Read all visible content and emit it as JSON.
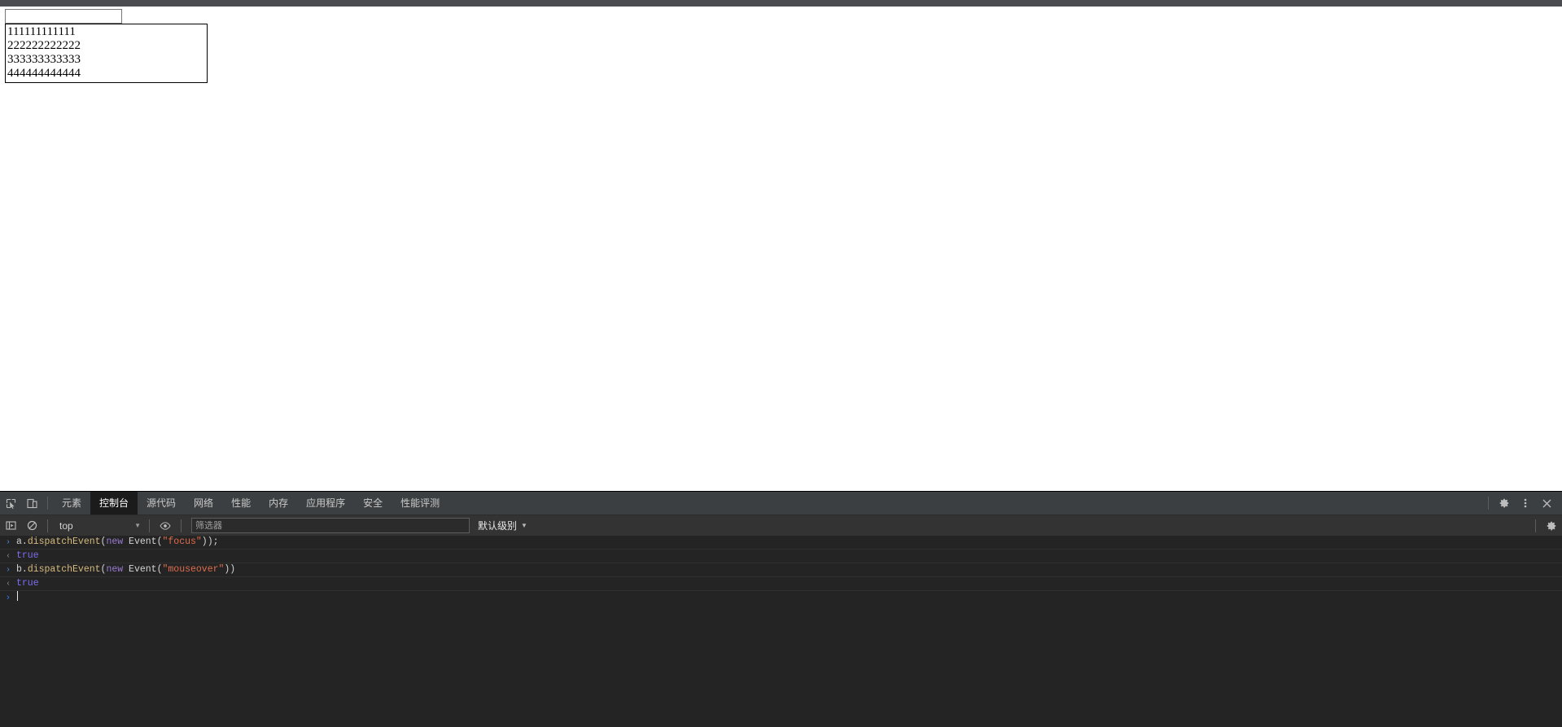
{
  "page": {
    "input_value": "",
    "input_placeholder": "",
    "textarea_value": "111111111111\n222222222222\n333333333333\n444444444444"
  },
  "devtools": {
    "tabbar": {
      "inspect_icon": "inspect-element-icon",
      "device_icon": "device-toolbar-icon",
      "tabs": [
        {
          "label": "元素",
          "name": "elements",
          "active": false
        },
        {
          "label": "控制台",
          "name": "console",
          "active": true
        },
        {
          "label": "源代码",
          "name": "sources",
          "active": false
        },
        {
          "label": "网络",
          "name": "network",
          "active": false
        },
        {
          "label": "性能",
          "name": "performance",
          "active": false
        },
        {
          "label": "内存",
          "name": "memory",
          "active": false
        },
        {
          "label": "应用程序",
          "name": "application",
          "active": false
        },
        {
          "label": "安全",
          "name": "security",
          "active": false
        },
        {
          "label": "性能评测",
          "name": "lighthouse",
          "active": false
        }
      ],
      "settings_icon": "gear-icon",
      "more_icon": "kebab-menu-icon",
      "close_icon": "close-icon"
    },
    "filterbar": {
      "sidebar_icon": "console-sidebar-icon",
      "clear_icon": "clear-console-icon",
      "context_value": "top",
      "context_caret": "▼",
      "eye_icon": "live-expression-icon",
      "filter_value": "",
      "filter_placeholder": "筛选器",
      "levels_label": "默认级别",
      "levels_caret": "▼",
      "settings_icon": "gear-icon"
    },
    "console": {
      "rows": [
        {
          "kind": "input",
          "gutter": "›",
          "tokens": [
            {
              "t": "a.",
              "c": "tok-ident"
            },
            {
              "t": "dispatchEvent",
              "c": "tok-method"
            },
            {
              "t": "(",
              "c": "tok-punct"
            },
            {
              "t": "new",
              "c": "tok-keyword"
            },
            {
              "t": " Event",
              "c": "tok-class"
            },
            {
              "t": "(",
              "c": "tok-punct"
            },
            {
              "t": "\"focus\"",
              "c": "tok-string"
            },
            {
              "t": "));",
              "c": "tok-punct"
            }
          ]
        },
        {
          "kind": "output",
          "gutter": "‹",
          "tokens": [
            {
              "t": "true",
              "c": "tok-bool"
            }
          ]
        },
        {
          "kind": "input",
          "gutter": "›",
          "tokens": [
            {
              "t": "b.",
              "c": "tok-ident"
            },
            {
              "t": "dispatchEvent",
              "c": "tok-method"
            },
            {
              "t": "(",
              "c": "tok-punct"
            },
            {
              "t": "new",
              "c": "tok-keyword"
            },
            {
              "t": " Event",
              "c": "tok-class"
            },
            {
              "t": "(",
              "c": "tok-punct"
            },
            {
              "t": "\"mouseover\"",
              "c": "tok-string"
            },
            {
              "t": "))",
              "c": "tok-punct"
            }
          ]
        },
        {
          "kind": "output",
          "gutter": "‹",
          "tokens": [
            {
              "t": "true",
              "c": "tok-bool"
            }
          ]
        }
      ],
      "prompt_gutter": "›",
      "prompt_value": ""
    }
  },
  "colors": {
    "chrome_strip": "#4a4c50",
    "tabbar_bg": "#3c3f41",
    "active_tab_bg": "#1b1b1b",
    "filterbar_bg": "#333333",
    "console_bg": "#242424",
    "prompt_blue": "#2f7bf6",
    "string_orange": "#e06c4b",
    "method_gold": "#d7ba7d",
    "keyword_purple": "#9a7ad4",
    "bool_blue": "#7c6cf0"
  }
}
